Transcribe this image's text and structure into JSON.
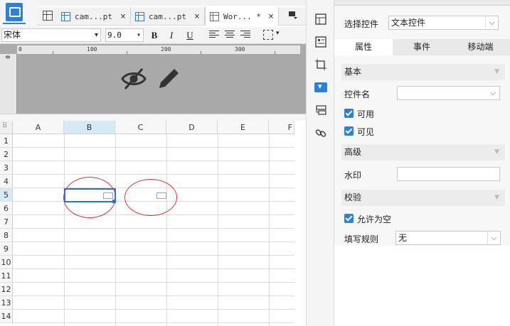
{
  "tabs": [
    {
      "label": "cam...pt",
      "close": "×"
    },
    {
      "label": "cam...pt",
      "close": "×"
    },
    {
      "label": "Wor... *",
      "close": "×"
    }
  ],
  "format_bar": {
    "font": "宋体",
    "size": "9.0",
    "bold": "B",
    "italic": "I",
    "underline": "U"
  },
  "ruler": {
    "marks": [
      "0",
      "100",
      "200",
      "300"
    ],
    "v_mark": "0"
  },
  "sheet": {
    "columns": [
      "A",
      "B",
      "C",
      "D",
      "E",
      "F"
    ],
    "rows": [
      "1",
      "2",
      "3",
      "4",
      "5",
      "6",
      "7",
      "8",
      "9",
      "10",
      "11",
      "12",
      "13",
      "14"
    ],
    "selected_cell": "B5"
  },
  "panel": {
    "select_control_label": "选择控件",
    "select_control_value": "文本控件",
    "tabs": [
      "属性",
      "事件",
      "移动端"
    ],
    "active_tab": "属性",
    "section_basic": "基本",
    "control_name_label": "控件名",
    "control_name_value": "",
    "enabled_label": "可用",
    "visible_label": "可见",
    "section_advanced": "高级",
    "watermark_label": "水印",
    "watermark_value": "",
    "section_validation": "校验",
    "allow_empty_label": "允许为空",
    "rule_label": "填写规则",
    "rule_value": "无"
  },
  "colors": {
    "accent": "#2f7ed8",
    "selection": "#2f6fd4",
    "annotation": "#e03232",
    "preview_bg": "#a9a9a9"
  },
  "icons": [
    "eye-slash-icon",
    "pencil-icon",
    "chevron-down-icon",
    "check-icon",
    "grid-icon",
    "link-icon"
  ]
}
